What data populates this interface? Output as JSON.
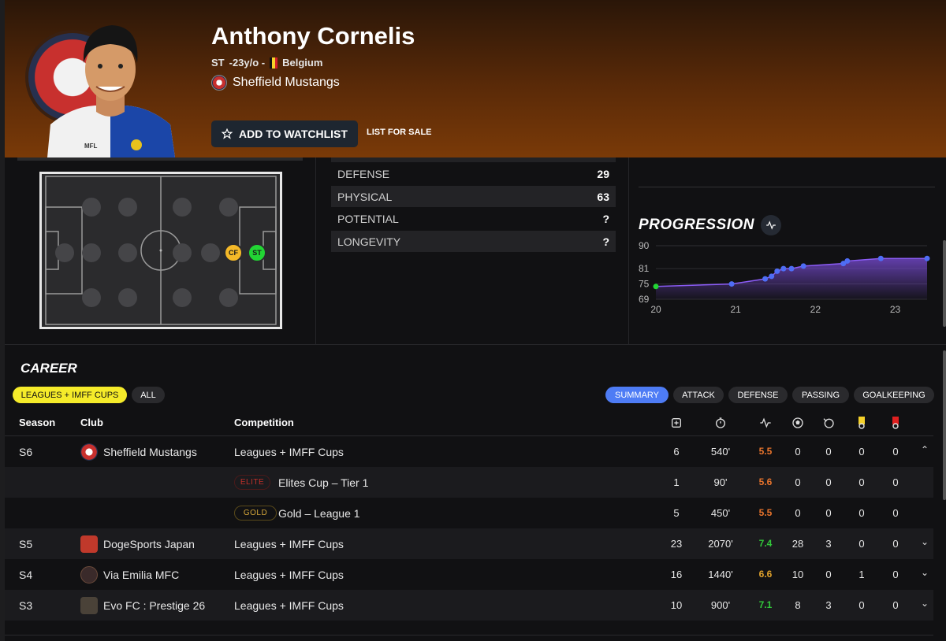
{
  "player": {
    "name": "Anthony Cornelis",
    "position": "ST",
    "age": "-23y/o -",
    "nationality": "Belgium",
    "club": "Sheffield Mustangs",
    "kit_text": "MFL"
  },
  "actions": {
    "watchlist_label": "ADD TO WATCHLIST",
    "sale_label": "LIST FOR SALE"
  },
  "positions": {
    "badges": [
      {
        "label": "CF",
        "color": "#f5b928"
      },
      {
        "label": "ST",
        "color": "#22d534"
      }
    ]
  },
  "attributes": [
    {
      "label": "DEFENSE",
      "value": "29"
    },
    {
      "label": "PHYSICAL",
      "value": "63"
    },
    {
      "label": "POTENTIAL",
      "value": "?"
    },
    {
      "label": "LONGEVITY",
      "value": "?"
    }
  ],
  "progression": {
    "title": "PROGRESSION"
  },
  "chart_data": {
    "type": "area",
    "title": "PROGRESSION",
    "xlabel": "",
    "ylabel": "",
    "xlim": [
      20,
      23.4
    ],
    "ylim": [
      69,
      90
    ],
    "x_ticks": [
      "20",
      "21",
      "22",
      "23"
    ],
    "y_ticks": [
      "90",
      "81",
      "75",
      "69"
    ],
    "series": [
      {
        "values": [
          {
            "x": 20.0,
            "y": 74
          },
          {
            "x": 20.95,
            "y": 75
          },
          {
            "x": 21.37,
            "y": 77
          },
          {
            "x": 21.45,
            "y": 78
          },
          {
            "x": 21.52,
            "y": 80
          },
          {
            "x": 21.6,
            "y": 81
          },
          {
            "x": 21.7,
            "y": 81
          },
          {
            "x": 21.85,
            "y": 82
          },
          {
            "x": 22.35,
            "y": 83
          },
          {
            "x": 22.4,
            "y": 84
          },
          {
            "x": 22.82,
            "y": 85
          },
          {
            "x": 23.4,
            "y": 85
          }
        ]
      }
    ],
    "colors": {
      "line": "#8b5cf6",
      "points": "#4f6df5",
      "first_point": "#22d534"
    }
  },
  "career": {
    "title": "CAREER",
    "filters": [
      "LEAGUES + IMFF CUPS",
      "ALL"
    ],
    "tabs": [
      "SUMMARY",
      "ATTACK",
      "DEFENSE",
      "PASSING",
      "GOALKEEPING"
    ],
    "headers": {
      "season": "Season",
      "club": "Club",
      "competition": "Competition"
    },
    "header_icons": [
      "matches-icon",
      "minutes-icon",
      "rating-icon",
      "goals-icon",
      "assists-icon",
      "yellow-card-icon",
      "red-card-icon"
    ],
    "rows": [
      {
        "season": "S6",
        "club": "Sheffield Mustangs",
        "competition": "Leagues + IMFF Cups",
        "mp": "6",
        "min": "540'",
        "rating": "5.5",
        "g": "0",
        "a": "0",
        "yc": "0",
        "rc": "0",
        "chev": "⌃"
      },
      {
        "season": "",
        "club": "",
        "tag": "ELITE",
        "competition": "Elites Cup – Tier 1",
        "mp": "1",
        "min": "90'",
        "rating": "5.6",
        "g": "0",
        "a": "0",
        "yc": "0",
        "rc": "0",
        "chev": ""
      },
      {
        "season": "",
        "club": "",
        "tag": "GOLD",
        "competition": "Gold – League 1",
        "mp": "5",
        "min": "450'",
        "rating": "5.5",
        "g": "0",
        "a": "0",
        "yc": "0",
        "rc": "0",
        "chev": ""
      },
      {
        "season": "S5",
        "club": "DogeSports Japan",
        "competition": "Leagues + IMFF Cups",
        "mp": "23",
        "min": "2070'",
        "rating": "7.4",
        "g": "28",
        "a": "3",
        "yc": "0",
        "rc": "0",
        "chev": "⌄"
      },
      {
        "season": "S4",
        "club": "Via Emilia MFC",
        "competition": "Leagues + IMFF Cups",
        "mp": "16",
        "min": "1440'",
        "rating": "6.6",
        "g": "10",
        "a": "0",
        "yc": "1",
        "rc": "0",
        "chev": "⌄"
      },
      {
        "season": "S3",
        "club": "Evo FC : Prestige 26",
        "competition": "Leagues + IMFF Cups",
        "mp": "10",
        "min": "900'",
        "rating": "7.1",
        "g": "8",
        "a": "3",
        "yc": "0",
        "rc": "0",
        "chev": "⌄"
      }
    ]
  }
}
